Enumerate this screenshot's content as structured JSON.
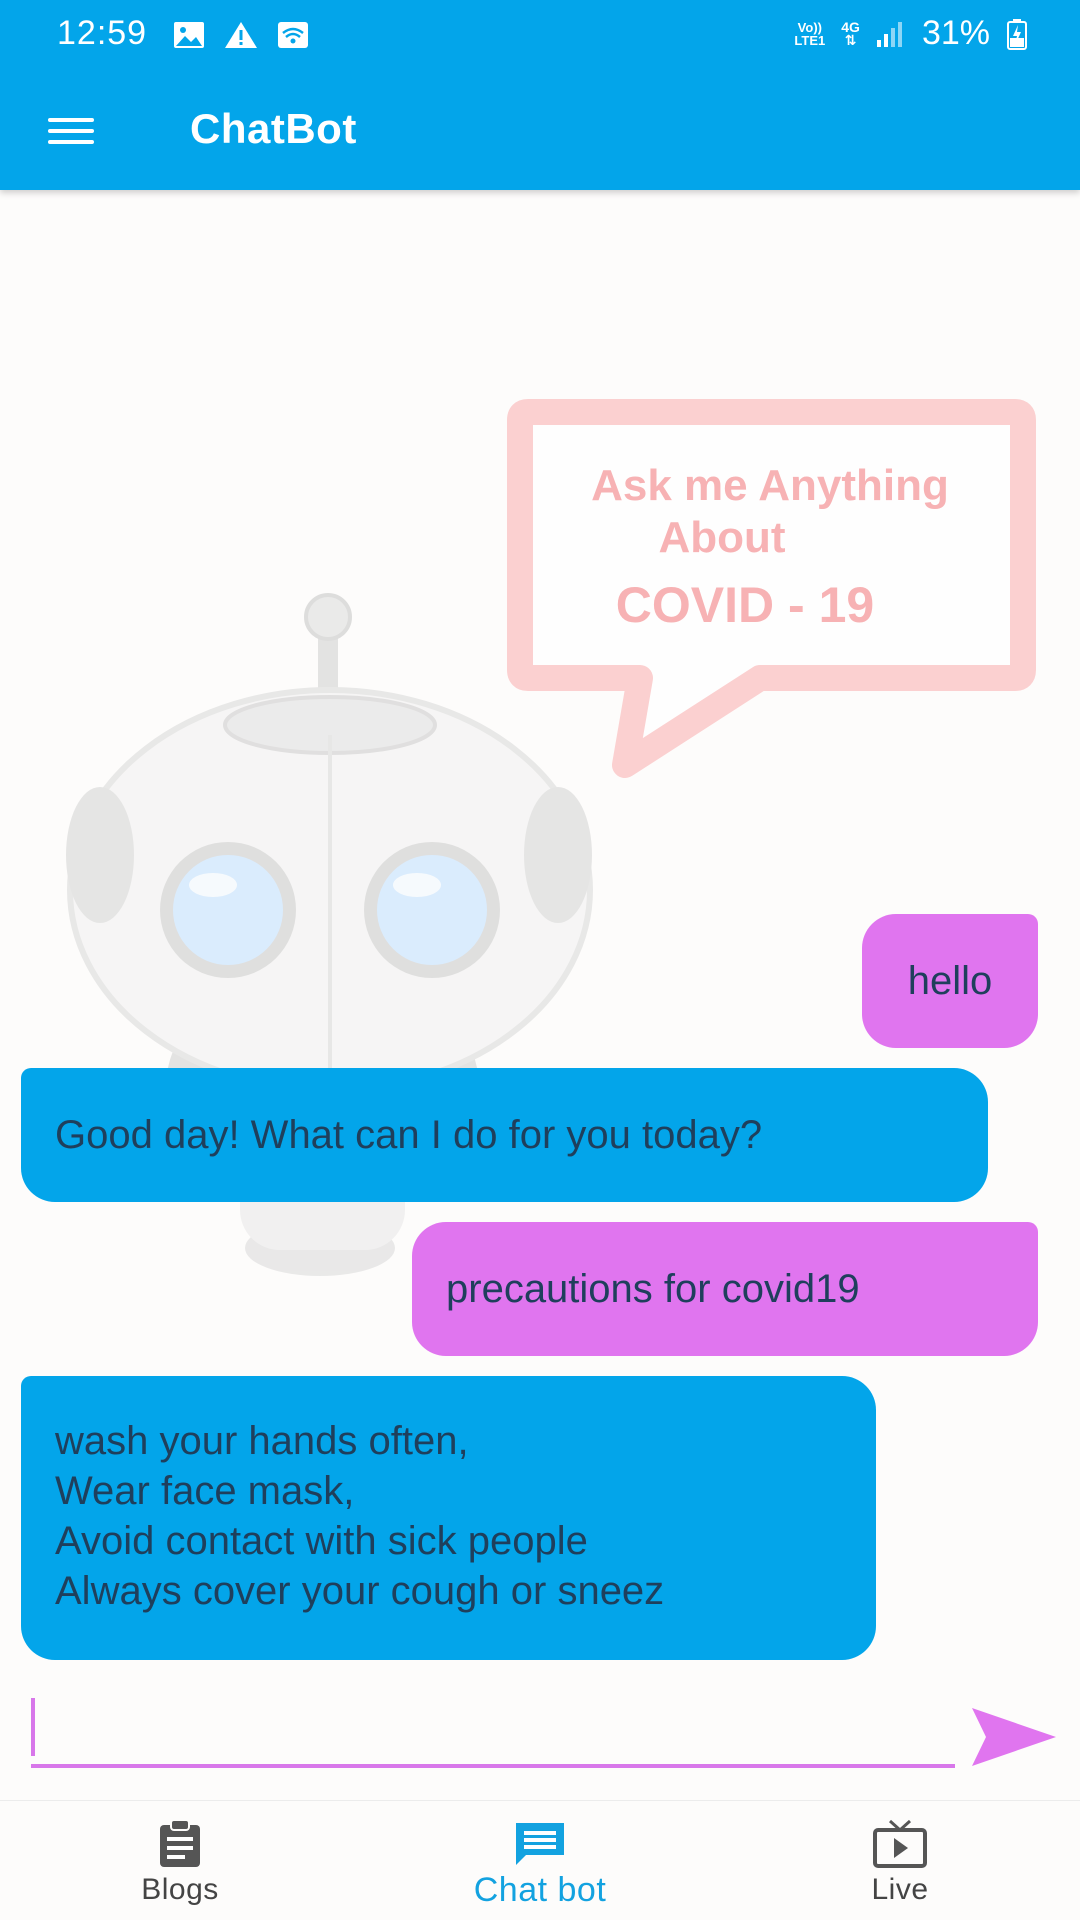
{
  "status_bar": {
    "time": "12:59",
    "icons": [
      "image-icon",
      "warning-icon",
      "wifi-icon"
    ],
    "volte_top": "Vo))",
    "volte_bottom": "LTE1",
    "network": "4G",
    "battery": "31%"
  },
  "app_bar": {
    "title": "ChatBot",
    "menu_icon": "hamburger-menu-icon"
  },
  "background_art": {
    "speech_line1": "Ask me Anything",
    "speech_line2": "About",
    "speech_line3": "COVID - 19"
  },
  "messages": [
    {
      "sender": "user",
      "text": "hello"
    },
    {
      "sender": "bot",
      "text": "Good day! What can I do for you today?"
    },
    {
      "sender": "user",
      "text": "precautions for covid19"
    },
    {
      "sender": "bot",
      "text": "wash your hands often,\nWear face mask,\nAvoid contact with sick people\nAlways cover your cough or sneez"
    }
  ],
  "input": {
    "value": "",
    "send_icon": "send-icon"
  },
  "bottom_nav": {
    "items": [
      {
        "label": "Blogs",
        "icon": "clipboard-icon"
      },
      {
        "label": "Chat bot",
        "icon": "chat-icon",
        "active": true
      },
      {
        "label": "Live",
        "icon": "tv-icon"
      }
    ]
  },
  "colors": {
    "primary": "#03a5ea",
    "user_bubble": "#e075ef",
    "accent": "#d877ea"
  }
}
